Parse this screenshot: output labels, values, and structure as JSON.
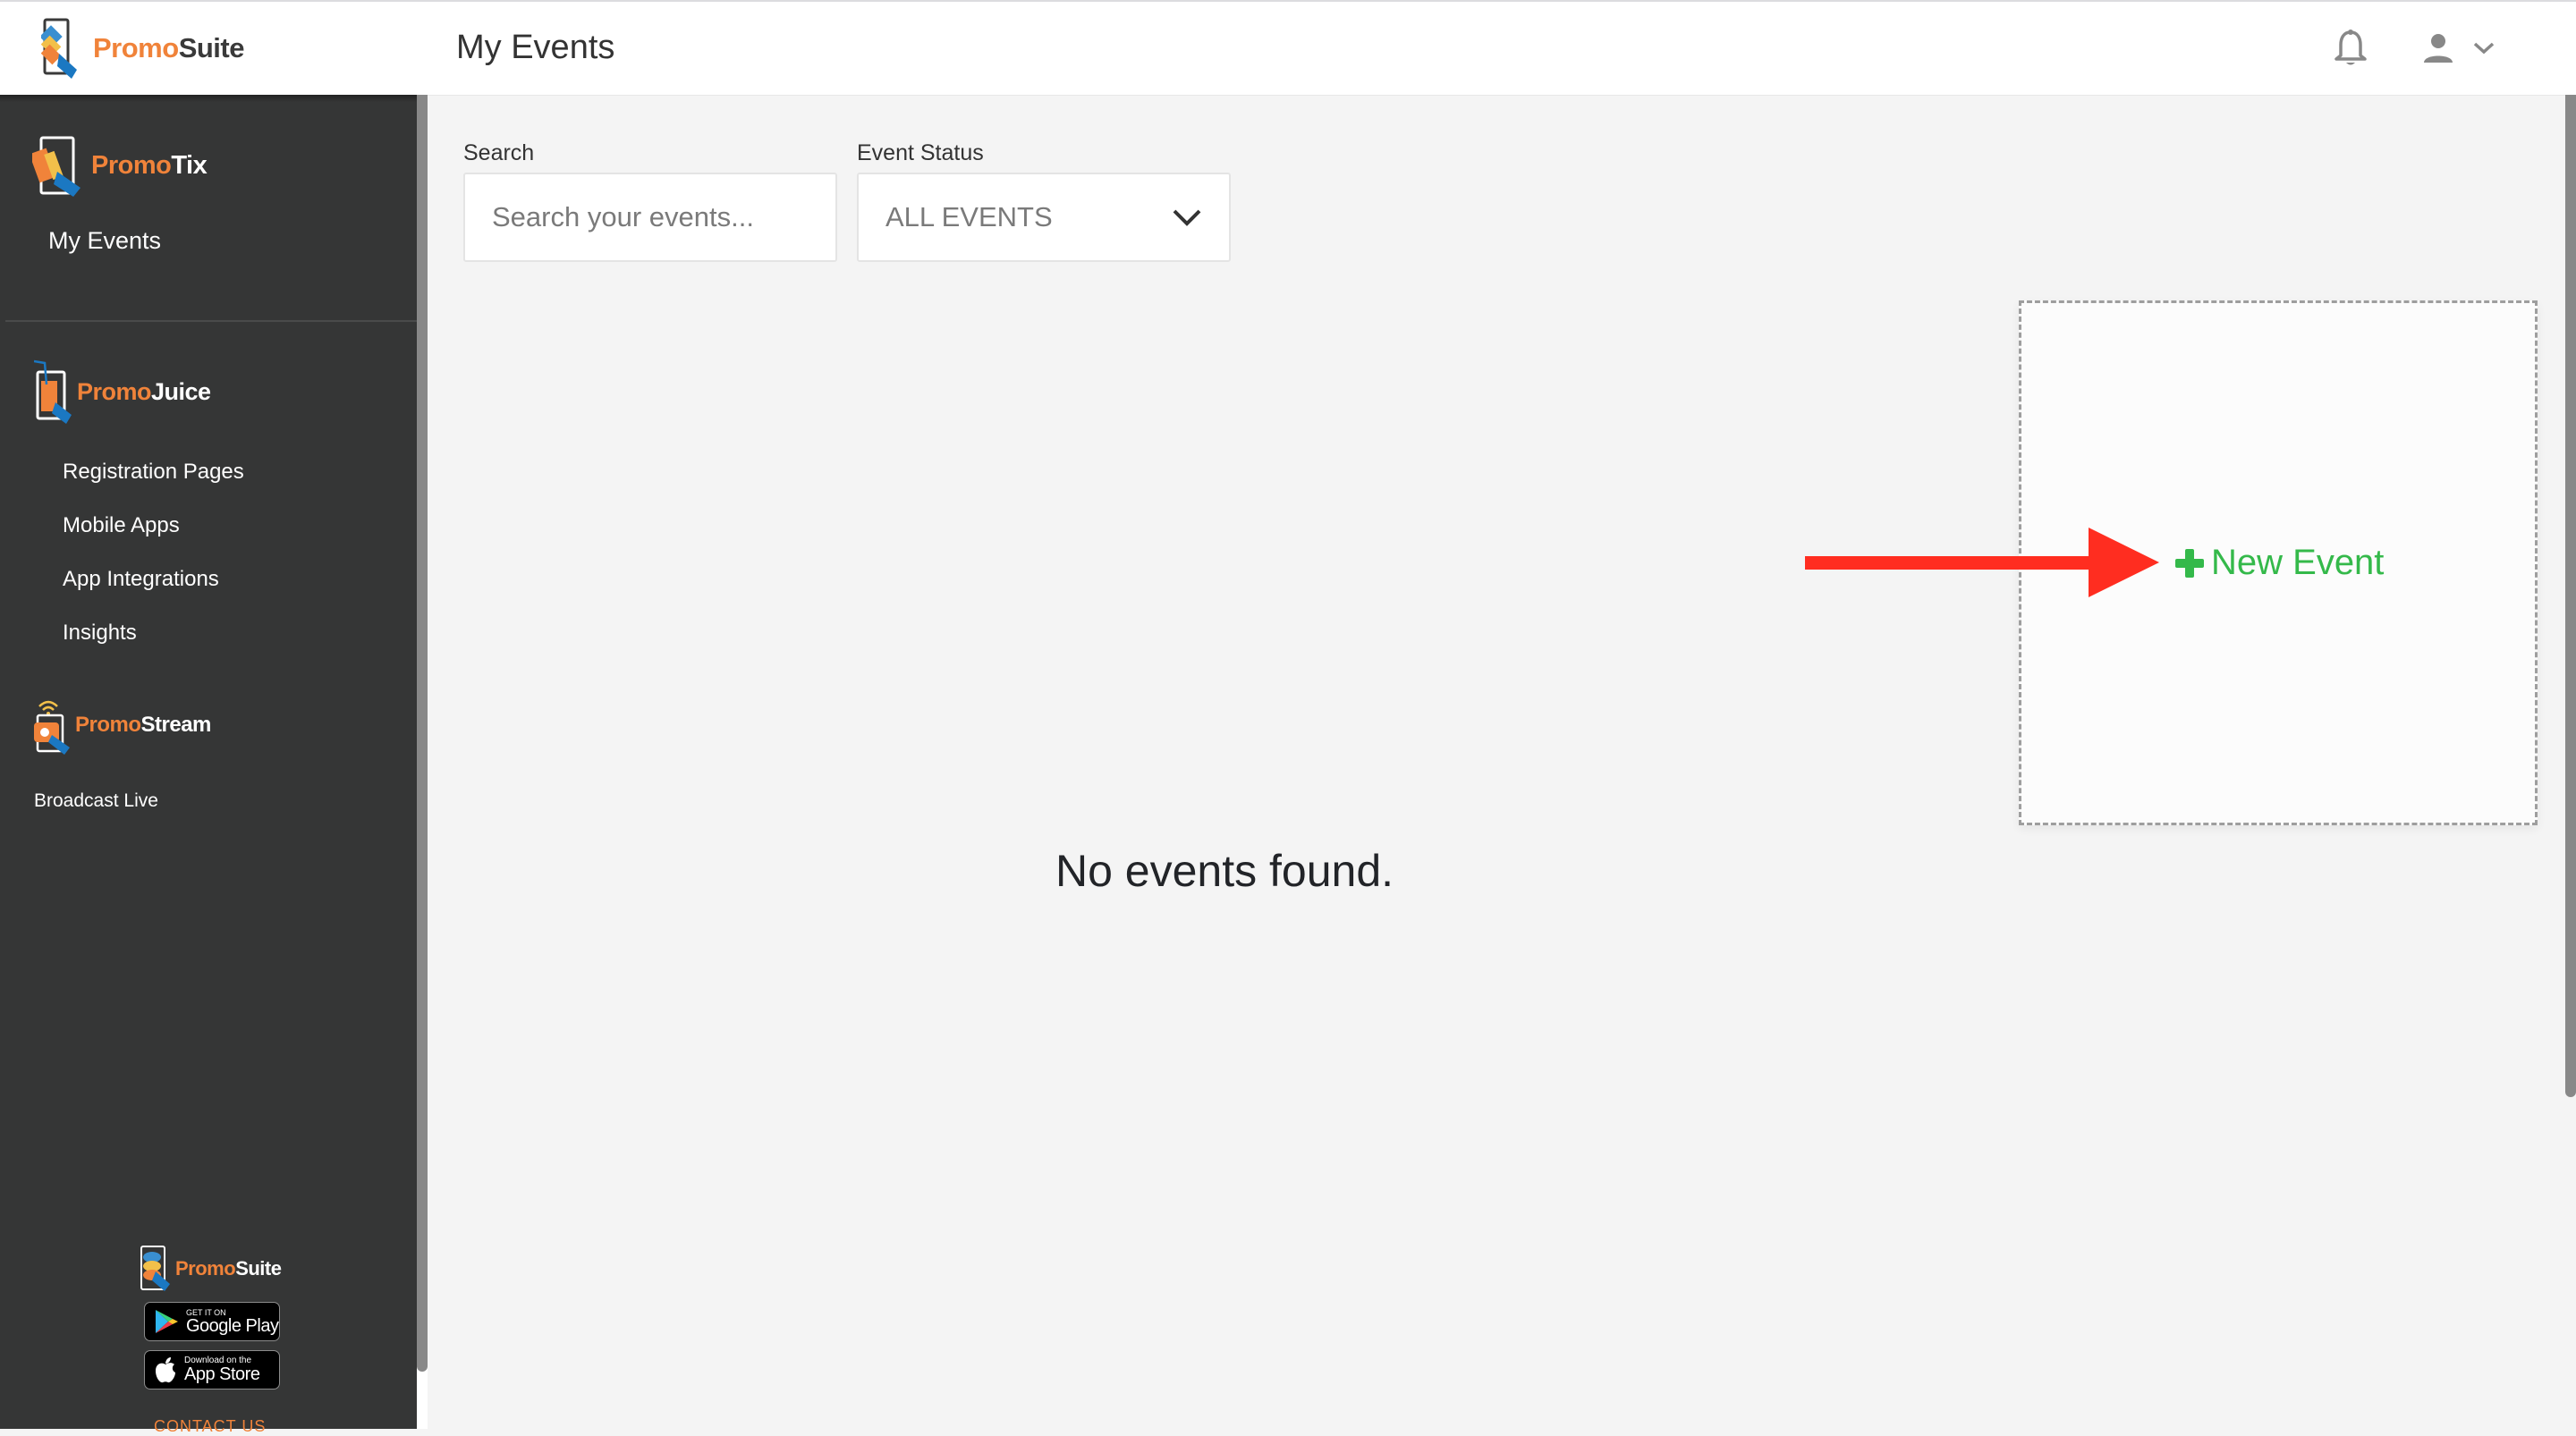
{
  "header": {
    "brand": {
      "part1": "Promo",
      "part2": "Suite"
    },
    "title": "My Events",
    "icons": {
      "notifications": "bell-icon",
      "account": "user-icon",
      "menu": "chevron-down-icon"
    }
  },
  "sidebar": {
    "sections": [
      {
        "brand": {
          "part1": "Promo",
          "part2": "Tix"
        },
        "items": [
          {
            "label": "My Events"
          }
        ]
      },
      {
        "brand": {
          "part1": "Promo",
          "part2": "Juice"
        },
        "items": [
          {
            "label": "Registration Pages"
          },
          {
            "label": "Mobile Apps"
          },
          {
            "label": "App Integrations"
          },
          {
            "label": "Insights"
          }
        ]
      },
      {
        "brand": {
          "part1": "Promo",
          "part2": "Stream"
        },
        "items": [
          {
            "label": "Broadcast Live"
          }
        ]
      }
    ],
    "footer": {
      "brand": {
        "part1": "Promo",
        "part2": "Suite"
      },
      "google_play": {
        "small": "GET IT ON",
        "big": "Google Play"
      },
      "app_store": {
        "small": "Download on the",
        "big": "App Store"
      },
      "contact": "CONTACT US"
    }
  },
  "filters": {
    "search": {
      "label": "Search",
      "placeholder": "Search your events...",
      "value": ""
    },
    "status": {
      "label": "Event Status",
      "selected": "ALL EVENTS"
    }
  },
  "main": {
    "new_event_label": "New Event",
    "empty_message": "No events found."
  },
  "colors": {
    "brand_orange": "#f0833a",
    "new_event_green": "#34b94a",
    "annotation_arrow": "#ff2d20",
    "sidebar_bg": "#353636"
  }
}
